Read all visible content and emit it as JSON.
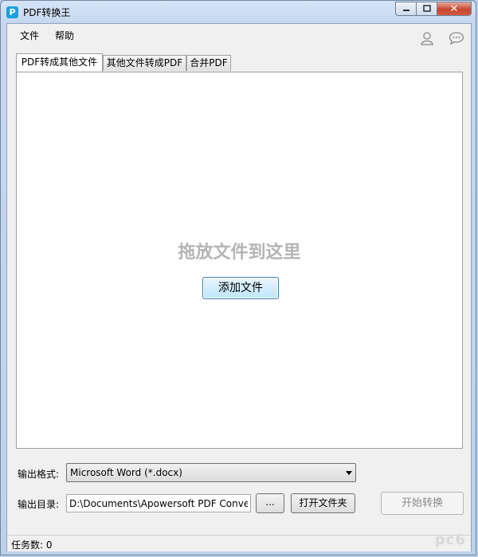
{
  "window": {
    "title": "PDF转换王",
    "app_icon": "P",
    "controls": {
      "minimize": "▭",
      "maximize": "□",
      "close": "✕"
    }
  },
  "menubar": {
    "items": [
      "文件",
      "帮助"
    ],
    "icons": [
      "user-icon",
      "chat-icon"
    ]
  },
  "tabs": [
    {
      "label": "PDF转成其他文件",
      "active": true
    },
    {
      "label": "其他文件转成PDF",
      "active": false
    },
    {
      "label": "合并PDF",
      "active": false
    }
  ],
  "panel": {
    "drop_hint": "拖放文件到这里",
    "add_button": "添加文件"
  },
  "output": {
    "format_label": "输出格式:",
    "format_value": "Microsoft Word (*.docx)",
    "dir_label": "输出目录:",
    "dir_value": "D:\\Documents\\Apowersoft PDF Conver",
    "browse_button": "...",
    "open_folder_button": "打开文件夹",
    "start_button": "开始转换"
  },
  "status": {
    "task_count": "任务数: 0"
  },
  "watermark": "pc6",
  "colors": {
    "accent": "#16a2dc",
    "close": "#c8462f",
    "hint": "#b4b4b4"
  }
}
